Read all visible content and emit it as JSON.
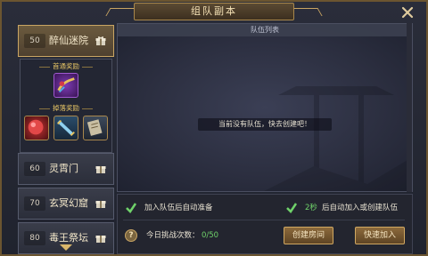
{
  "window": {
    "title": "组队副本"
  },
  "sidebar": {
    "items": [
      {
        "level": "50",
        "name": "醉仙迷院",
        "active": true
      },
      {
        "level": "60",
        "name": "灵霄门"
      },
      {
        "level": "70",
        "name": "玄冥幻窟"
      },
      {
        "level": "80",
        "name": "毒王祭坛"
      }
    ],
    "first_reward_label": "首通奖励",
    "drop_reward_label": "掉落奖励",
    "first_reward_icon": "weapon-scroll-icon",
    "drop_reward_icons": [
      "red-orb-icon",
      "blue-scroll-icon",
      "skill-book-icon"
    ]
  },
  "team_list": {
    "header": "队伍列表",
    "empty_message": "当前没有队伍，快去创建吧！"
  },
  "options": {
    "auto_ready": "加入队伍后自动准备",
    "auto_join_seconds": "2秒",
    "auto_join_suffix": "后自动加入或创建队伍"
  },
  "challenge": {
    "label": "今日挑战次数：",
    "count": "0/50"
  },
  "buttons": {
    "create_room": "创建房间",
    "quick_join": "快速加入"
  },
  "colors": {
    "gold_border": "#c9a563",
    "accent_green": "#6fd26a",
    "count_green": "#6fd26a"
  }
}
